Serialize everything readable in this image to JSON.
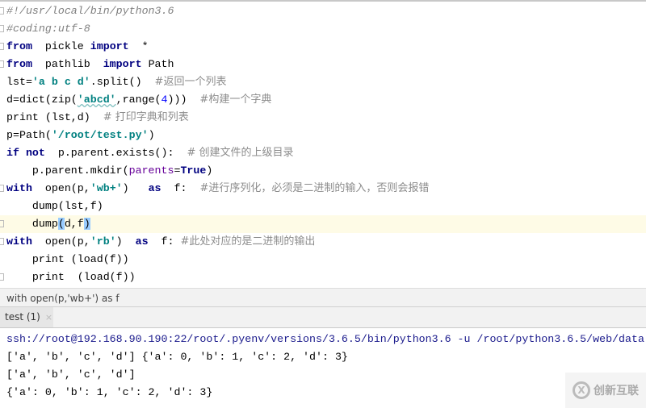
{
  "editor": {
    "current_line": 12,
    "lines": [
      {
        "fold": true,
        "tokens": [
          [
            "#!/usr/local/bin/python3.6",
            "comment"
          ]
        ]
      },
      {
        "fold": true,
        "tokens": [
          [
            "#coding:utf-8",
            "comment"
          ]
        ]
      },
      {
        "fold": true,
        "tokens": [
          [
            "from",
            "kw"
          ],
          [
            "  pickle ",
            ""
          ],
          [
            "import",
            "kw"
          ],
          [
            "  *",
            ""
          ]
        ]
      },
      {
        "fold": true,
        "tokens": [
          [
            "from",
            "kw"
          ],
          [
            "  pathlib  ",
            ""
          ],
          [
            "import",
            "kw"
          ],
          [
            " Path",
            ""
          ]
        ]
      },
      {
        "fold": false,
        "tokens": [
          [
            "lst=",
            ""
          ],
          [
            "'a b c d'",
            "str"
          ],
          [
            ".split()  ",
            ""
          ],
          [
            "#返回一个列表",
            "zh"
          ]
        ]
      },
      {
        "fold": false,
        "tokens": [
          [
            "d=dict(zip(",
            ""
          ],
          [
            "'abcd'",
            "str ul"
          ],
          [
            ",range(",
            ""
          ],
          [
            "4",
            "num"
          ],
          [
            ")))  ",
            ""
          ],
          [
            "#构建一个字典",
            "zh"
          ]
        ]
      },
      {
        "fold": false,
        "tokens": [
          [
            "print (lst,d)  ",
            ""
          ],
          [
            "# 打印字典和列表",
            "zh"
          ]
        ]
      },
      {
        "fold": false,
        "tokens": [
          [
            "p=Path(",
            ""
          ],
          [
            "'/root/test.py'",
            "str"
          ],
          [
            ")",
            ""
          ]
        ]
      },
      {
        "fold": false,
        "tokens": [
          [
            "if not",
            "kw"
          ],
          [
            "  p.parent.exists():  ",
            ""
          ],
          [
            "# 创建文件的上级目录",
            "zh"
          ]
        ]
      },
      {
        "fold": false,
        "tokens": [
          [
            "    p.parent.mkdir(",
            ""
          ],
          [
            "parents",
            "param"
          ],
          [
            "=",
            ""
          ],
          [
            "True",
            "kw"
          ],
          [
            ")",
            ""
          ]
        ]
      },
      {
        "fold": true,
        "tokens": [
          [
            "with",
            "kw"
          ],
          [
            "  open(p,",
            ""
          ],
          [
            "'wb+'",
            "str"
          ],
          [
            ")   ",
            ""
          ],
          [
            "as",
            "kw"
          ],
          [
            "  f:  ",
            ""
          ],
          [
            "#进行序列化，必须是二进制的输入，否则会报错",
            "zh"
          ]
        ]
      },
      {
        "fold": false,
        "tokens": [
          [
            "    dump(lst,f)",
            ""
          ]
        ]
      },
      {
        "fold": true,
        "tokens": [
          [
            "    dump",
            ""
          ],
          [
            "(",
            "match"
          ],
          [
            "d,f",
            ""
          ],
          [
            ")",
            "match"
          ]
        ]
      },
      {
        "fold": true,
        "tokens": [
          [
            "with",
            "kw"
          ],
          [
            "  open(p,",
            ""
          ],
          [
            "'rb'",
            "str"
          ],
          [
            ")  ",
            ""
          ],
          [
            "as",
            "kw"
          ],
          [
            "  f: ",
            ""
          ],
          [
            "#此处对应的是二进制的输出",
            "zh"
          ]
        ]
      },
      {
        "fold": false,
        "tokens": [
          [
            "    print (load(f))",
            ""
          ]
        ]
      },
      {
        "fold": true,
        "tokens": [
          [
            "    print  (load(f))",
            ""
          ]
        ]
      }
    ]
  },
  "breadcrumb": "with open(p,'wb+') as f",
  "run_tab": {
    "label": "test (1)",
    "close": "×"
  },
  "console": {
    "lines": [
      "ssh://root@192.168.90.190:22/root/.pyenv/versions/3.6.5/bin/python3.6 -u /root/python3.6.5/web/data",
      "['a', 'b', 'c', 'd'] {'a': 0, 'b': 1, 'c': 2, 'd': 3}",
      "['a', 'b', 'c', 'd']",
      "{'a': 0, 'b': 1, 'c': 2, 'd': 3}"
    ]
  },
  "watermark": {
    "text": "创新互联",
    "logo": "X"
  }
}
